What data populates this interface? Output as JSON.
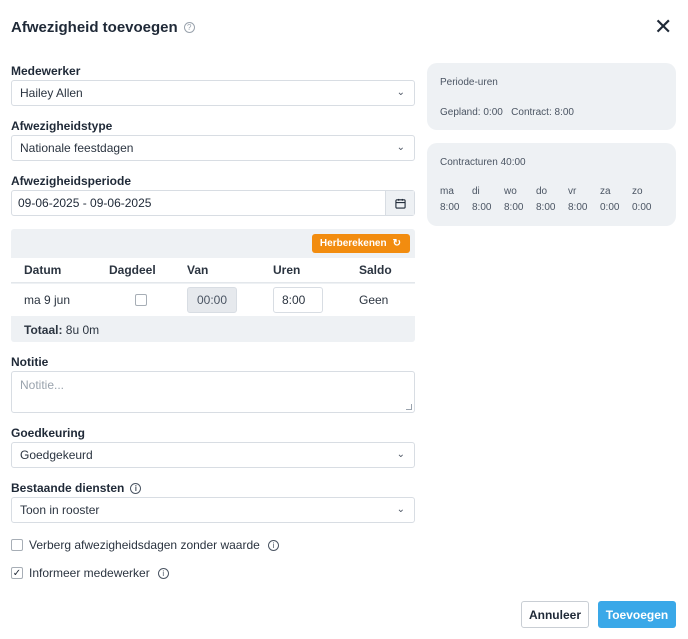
{
  "dialog": {
    "title": "Afwezigheid toevoegen",
    "help_icon": "question-circle-icon",
    "close_icon": "close-icon"
  },
  "form": {
    "employee": {
      "label": "Medewerker",
      "value": "Hailey Allen"
    },
    "absence_type": {
      "label": "Afwezigheidstype",
      "value": "Nationale feestdagen"
    },
    "period": {
      "label": "Afwezigheidsperiode",
      "value": "09-06-2025 - 09-06-2025",
      "icon": "calendar-icon"
    },
    "table": {
      "recalc_label": "Herberekenen",
      "columns": [
        "Datum",
        "Dagdeel",
        "Van",
        "Uren",
        "Saldo"
      ],
      "rows": [
        {
          "datum": "ma 9 jun",
          "dagdeel": false,
          "van": "00:00",
          "uren": "8:00",
          "saldo": "Geen"
        }
      ],
      "total_label": "Totaal:",
      "total_value": "8u 0m"
    },
    "note": {
      "label": "Notitie",
      "placeholder": "Notitie..."
    },
    "approval": {
      "label": "Goedkeuring",
      "value": "Goedgekeurd"
    },
    "existing_shifts": {
      "label": "Bestaande diensten",
      "value": "Toon in rooster"
    },
    "hide_days": {
      "label": "Verberg afwezigheidsdagen zonder waarde",
      "checked": false
    },
    "inform": {
      "label": "Informeer medewerker",
      "checked": true
    }
  },
  "period_hours": {
    "title": "Periode-uren",
    "planned": "Gepland: 0:00",
    "contract": "Contract: 8:00"
  },
  "contract_hours": {
    "title": "Contracturen 40:00",
    "days": [
      "ma",
      "di",
      "wo",
      "do",
      "vr",
      "za",
      "zo"
    ],
    "hours": [
      "8:00",
      "8:00",
      "8:00",
      "8:00",
      "8:00",
      "0:00",
      "0:00"
    ]
  },
  "buttons": {
    "cancel": "Annuleer",
    "add": "Toevoegen"
  }
}
